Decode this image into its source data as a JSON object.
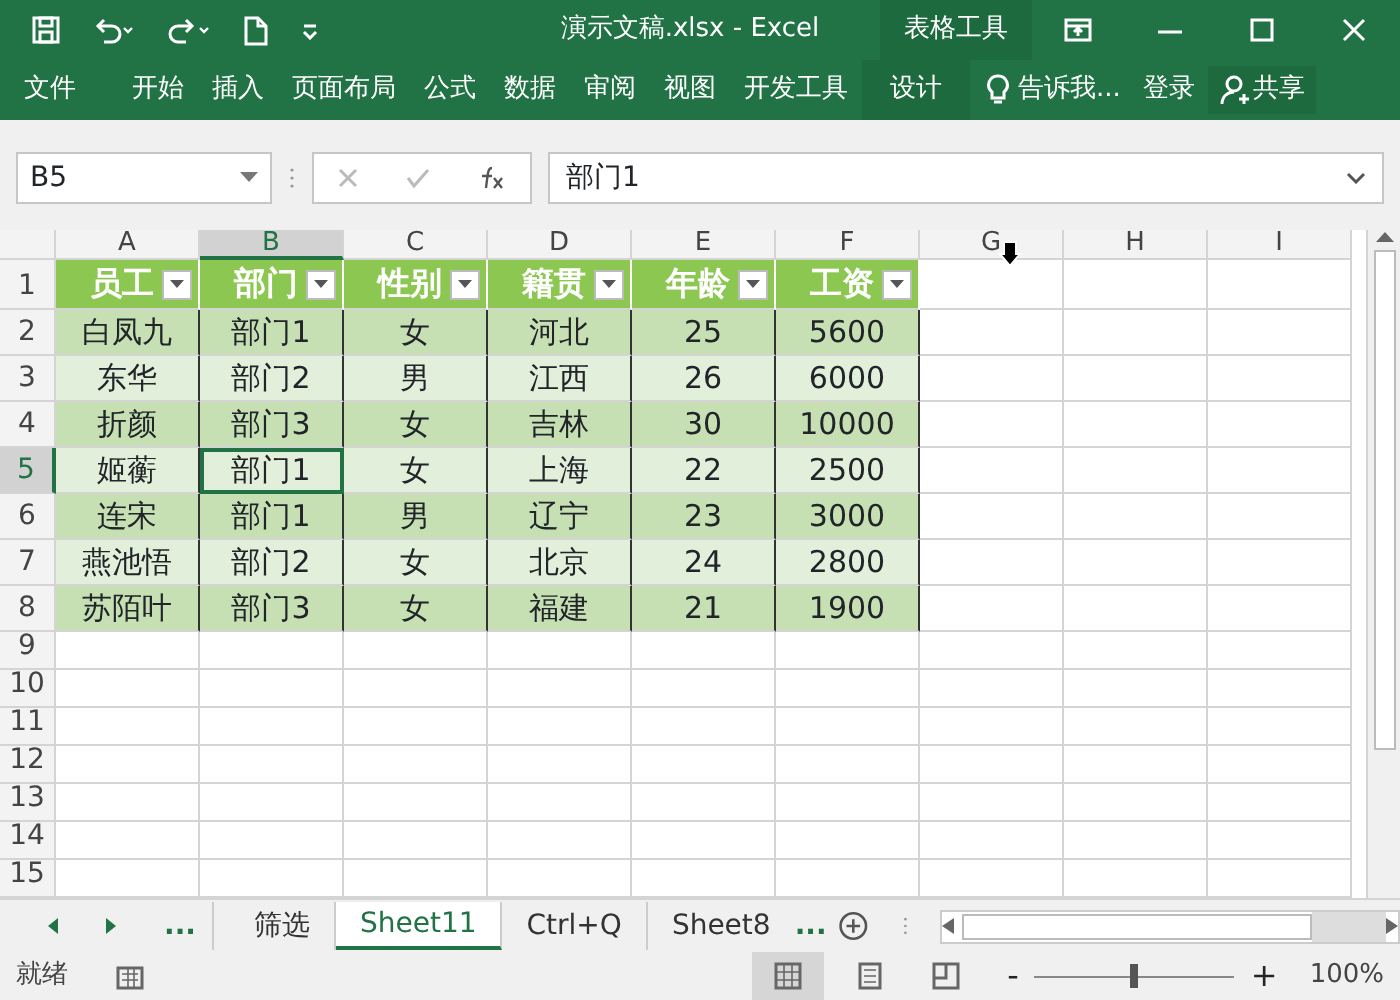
{
  "window": {
    "title": "演示文稿.xlsx - Excel",
    "contextual_group": "表格工具"
  },
  "ribbon_tabs": [
    {
      "label": "文件",
      "kind": "normal"
    },
    {
      "label": "开始",
      "kind": "normal"
    },
    {
      "label": "插入",
      "kind": "normal"
    },
    {
      "label": "页面布局",
      "kind": "normal"
    },
    {
      "label": "公式",
      "kind": "normal"
    },
    {
      "label": "数据",
      "kind": "normal"
    },
    {
      "label": "审阅",
      "kind": "normal"
    },
    {
      "label": "视图",
      "kind": "normal"
    },
    {
      "label": "开发工具",
      "kind": "normal"
    },
    {
      "label": "设计",
      "kind": "contextual"
    }
  ],
  "tell_me": "告诉我...",
  "sign_in": "登录",
  "share": "共享",
  "formula_bar": {
    "name_box": "B5",
    "formula": "部门1"
  },
  "columns": [
    {
      "label": "A",
      "selected": false
    },
    {
      "label": "B",
      "selected": true
    },
    {
      "label": "C",
      "selected": false
    },
    {
      "label": "D",
      "selected": false
    },
    {
      "label": "E",
      "selected": false
    },
    {
      "label": "F",
      "selected": false
    },
    {
      "label": "G",
      "selected": false
    },
    {
      "label": "H",
      "selected": false
    },
    {
      "label": "I",
      "selected": false
    }
  ],
  "row_numbers": [
    {
      "label": "1",
      "selected": false
    },
    {
      "label": "2",
      "selected": false
    },
    {
      "label": "3",
      "selected": false
    },
    {
      "label": "4",
      "selected": false
    },
    {
      "label": "5",
      "selected": true
    },
    {
      "label": "6",
      "selected": false
    },
    {
      "label": "7",
      "selected": false
    },
    {
      "label": "8",
      "selected": false
    },
    {
      "label": "9",
      "selected": false
    },
    {
      "label": "10",
      "selected": false
    },
    {
      "label": "11",
      "selected": false
    },
    {
      "label": "12",
      "selected": false
    },
    {
      "label": "13",
      "selected": false
    },
    {
      "label": "14",
      "selected": false
    },
    {
      "label": "15",
      "selected": false
    }
  ],
  "table": {
    "headers": [
      "员工",
      "部门",
      "性别",
      "籍贯",
      "年龄",
      "工资"
    ],
    "rows": [
      [
        {
          "text": "白凤九",
          "selected": false
        },
        {
          "text": "部门1",
          "selected": false
        },
        {
          "text": "女",
          "selected": false
        },
        {
          "text": "河北",
          "selected": false
        },
        {
          "text": "25",
          "selected": false
        },
        {
          "text": "5600",
          "selected": false
        }
      ],
      [
        {
          "text": "东华",
          "selected": false
        },
        {
          "text": "部门2",
          "selected": false
        },
        {
          "text": "男",
          "selected": false
        },
        {
          "text": "江西",
          "selected": false
        },
        {
          "text": "26",
          "selected": false
        },
        {
          "text": "6000",
          "selected": false
        }
      ],
      [
        {
          "text": "折颜",
          "selected": false
        },
        {
          "text": "部门3",
          "selected": false
        },
        {
          "text": "女",
          "selected": false
        },
        {
          "text": "吉林",
          "selected": false
        },
        {
          "text": "30",
          "selected": false
        },
        {
          "text": "10000",
          "selected": false
        }
      ],
      [
        {
          "text": "姬蘅",
          "selected": false
        },
        {
          "text": "部门1",
          "selected": true
        },
        {
          "text": "女",
          "selected": false
        },
        {
          "text": "上海",
          "selected": false
        },
        {
          "text": "22",
          "selected": false
        },
        {
          "text": "2500",
          "selected": false
        }
      ],
      [
        {
          "text": "连宋",
          "selected": false
        },
        {
          "text": "部门1",
          "selected": false
        },
        {
          "text": "男",
          "selected": false
        },
        {
          "text": "辽宁",
          "selected": false
        },
        {
          "text": "23",
          "selected": false
        },
        {
          "text": "3000",
          "selected": false
        }
      ],
      [
        {
          "text": "燕池悟",
          "selected": false
        },
        {
          "text": "部门2",
          "selected": false
        },
        {
          "text": "女",
          "selected": false
        },
        {
          "text": "北京",
          "selected": false
        },
        {
          "text": "24",
          "selected": false
        },
        {
          "text": "2800",
          "selected": false
        }
      ],
      [
        {
          "text": "苏陌叶",
          "selected": false
        },
        {
          "text": "部门3",
          "selected": false
        },
        {
          "text": "女",
          "selected": false
        },
        {
          "text": "福建",
          "selected": false
        },
        {
          "text": "21",
          "selected": false
        },
        {
          "text": "1900",
          "selected": false
        }
      ]
    ]
  },
  "sheet_tabs": [
    {
      "label": "筛选",
      "selected": false
    },
    {
      "label": "Sheet11",
      "selected": true
    },
    {
      "label": "Ctrl+Q",
      "selected": false
    },
    {
      "label": "Sheet8",
      "selected": false
    }
  ],
  "sheet_nav_more": "...",
  "sheet_tabs_more": "...",
  "status_bar": {
    "text": "就绪",
    "zoom": "100%",
    "zoom_minus": "-",
    "zoom_plus": "+",
    "zoom_slider": {
      "level": 0.5
    }
  }
}
